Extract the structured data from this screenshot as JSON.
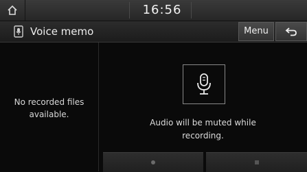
{
  "status": {
    "time": "16:56"
  },
  "header": {
    "title": "Voice memo",
    "menu_label": "Menu"
  },
  "left_panel": {
    "empty_line1": "No recorded files",
    "empty_line2": "available."
  },
  "right_panel": {
    "mute_line1": "Audio will be muted while",
    "mute_line2": "recording."
  },
  "icons": {
    "home": "home-icon",
    "memo": "voice-memo-icon",
    "back": "back-arrow-icon",
    "mic": "microphone-icon",
    "record": "record-icon",
    "stop": "stop-icon"
  },
  "colors": {
    "background": "#0a0a0a",
    "bar": "#2c2c2c",
    "text": "#e6e6e6"
  }
}
